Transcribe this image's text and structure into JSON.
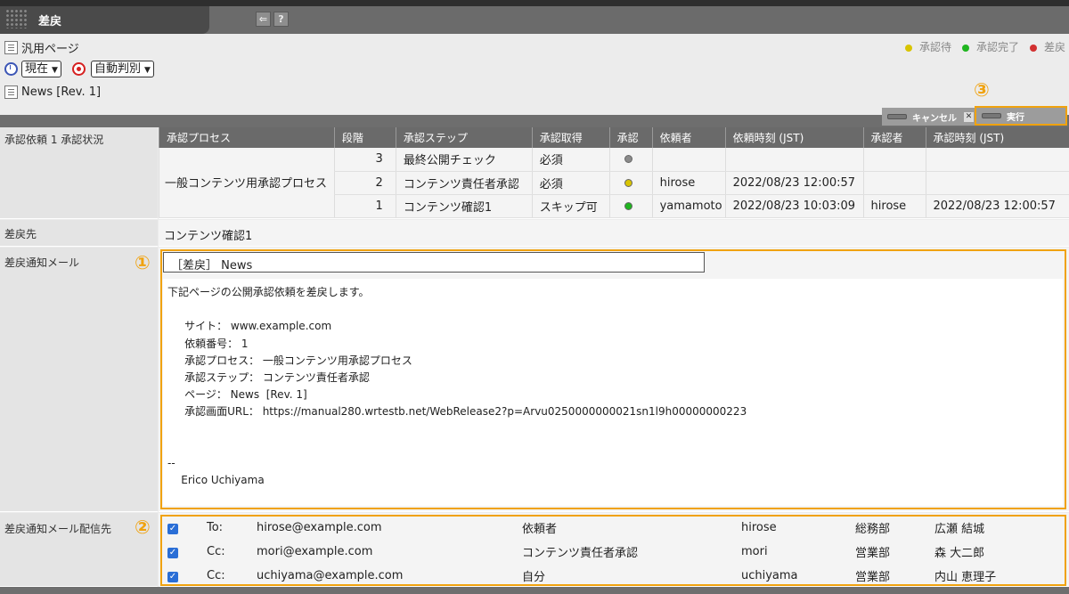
{
  "window": {
    "title": "差戻",
    "back_icon": "arrow-left-icon",
    "help_label": "?"
  },
  "info": {
    "page_type": "汎用ページ",
    "time_select": "現在",
    "judge_select": "自動判別",
    "page_name": "News [Rev. 1]"
  },
  "legend": [
    {
      "label": "承認待",
      "color": "#d8c400"
    },
    {
      "label": "承認完了",
      "color": "#1fb51f"
    },
    {
      "label": "差戻",
      "color": "#d23030"
    }
  ],
  "actions": {
    "cancel": "キャンセル",
    "cancel_x": "✕",
    "execute": "実行"
  },
  "markers": {
    "one": "①",
    "two": "②",
    "three": "③"
  },
  "status": {
    "label": "承認依頼 1 承認状況",
    "headers": [
      "承認プロセス",
      "段階",
      "承認ステップ",
      "承認取得",
      "承認",
      "依頼者",
      "依頼時刻 (JST)",
      "承認者",
      "承認時刻 (JST)"
    ],
    "process_name": "一般コンテンツ用承認プロセス",
    "rows": [
      {
        "stage": "3",
        "step": "最終公開チェック",
        "acquire": "必須",
        "dot": "#8a8a8a",
        "requester": "",
        "req_time": "",
        "approver": "",
        "appr_time": ""
      },
      {
        "stage": "2",
        "step": "コンテンツ責任者承認",
        "acquire": "必須",
        "dot": "#d8c400",
        "requester": "hirose",
        "req_time": "2022/08/23 12:00:57",
        "approver": "",
        "appr_time": ""
      },
      {
        "stage": "1",
        "step": "コンテンツ確認1",
        "acquire": "スキップ可",
        "dot": "#1fb51f",
        "requester": "yamamoto",
        "req_time": "2022/08/23 10:03:09",
        "approver": "hirose",
        "appr_time": "2022/08/23 12:00:57"
      }
    ]
  },
  "return_to": {
    "label": "差戻先",
    "value": "コンテンツ確認1"
  },
  "mail": {
    "label": "差戻通知メール",
    "subject": "［差戻］ News",
    "body": "下記ページの公開承認依頼を差戻します。\n\n     サイト： www.example.com\n     依頼番号： 1\n     承認プロセス： 一般コンテンツ用承認プロセス\n     承認ステップ： コンテンツ責任者承認\n     ページ： News  [Rev. 1]\n     承認画面URL： https://manual280.wrtestb.net/WebRelease2?p=Arvu0250000000021sn1l9h00000000223\n\n\n--\n    Erico Uchiyama"
  },
  "recipients": {
    "label": "差戻通知メール配信先",
    "rows": [
      {
        "type": "To:",
        "email": "hirose@example.com",
        "role": "依頼者",
        "user": "hirose",
        "dept": "総務部",
        "name": "広瀬 結城"
      },
      {
        "type": "Cc:",
        "email": "mori@example.com",
        "role": "コンテンツ責任者承認",
        "user": "mori",
        "dept": "営業部",
        "name": "森 大二郎"
      },
      {
        "type": "Cc:",
        "email": "uchiyama@example.com",
        "role": "自分",
        "user": "uchiyama",
        "dept": "営業部",
        "name": "内山 恵理子"
      }
    ]
  }
}
